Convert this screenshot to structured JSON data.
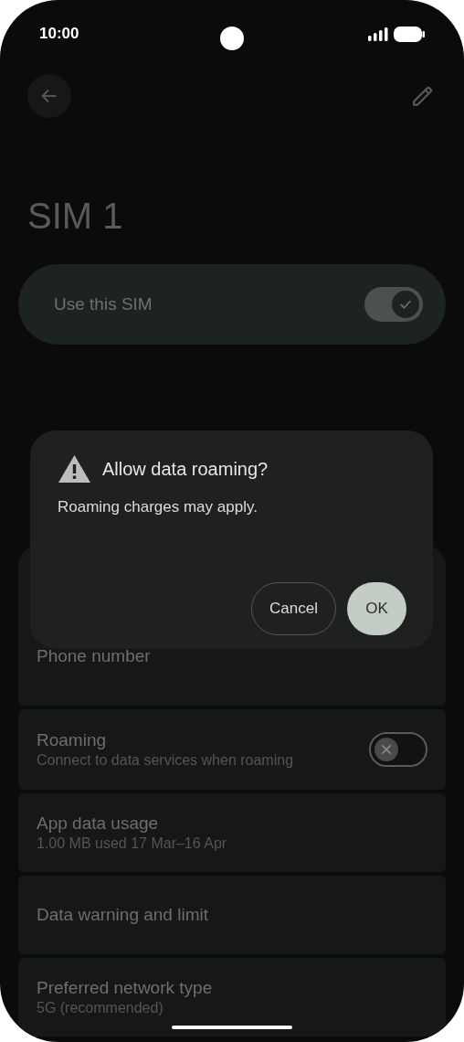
{
  "status_bar": {
    "time": "10:00"
  },
  "header": {
    "title": "SIM 1"
  },
  "use_sim": {
    "label": "Use this SIM",
    "on": true
  },
  "dialog": {
    "title": "Allow data roaming?",
    "message": "Roaming charges may apply.",
    "buttons": [
      {
        "label": "Cancel",
        "kind": "outlined"
      },
      {
        "label": "OK",
        "kind": "filled"
      }
    ]
  },
  "settings": [
    {
      "kind": "text",
      "title": "Phone number"
    },
    {
      "kind": "switch",
      "title": "Roaming",
      "subtitle": "Connect to data services when roaming",
      "on": false
    },
    {
      "kind": "text",
      "title": "App data usage",
      "subtitle": "1.00 MB used 17 Mar–16 Apr"
    },
    {
      "kind": "text",
      "title": "Data warning and limit"
    },
    {
      "kind": "text",
      "title": "Preferred network type",
      "subtitle": "5G (recommended)"
    }
  ]
}
